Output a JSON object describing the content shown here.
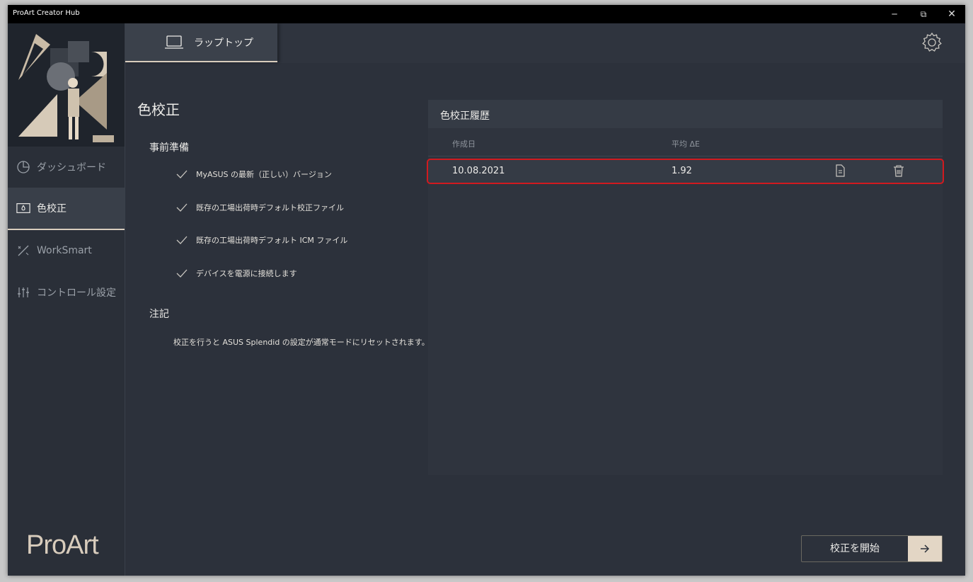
{
  "window": {
    "title": "ProArt Creator Hub"
  },
  "titlebar": {
    "minimize": "─",
    "maximize": "⧉",
    "close": "✕"
  },
  "sidebar": {
    "items": [
      {
        "label": "ダッシュボード",
        "icon": "pie-chart-icon"
      },
      {
        "label": "色校正",
        "icon": "calibration-icon",
        "active": true
      },
      {
        "label": "WorkSmart",
        "icon": "magic-wand-icon"
      },
      {
        "label": "コントロール設定",
        "icon": "sliders-icon"
      }
    ],
    "logo": "ProArt"
  },
  "topbar": {
    "tab_label": "ラップトップ",
    "tab_icon": "laptop-icon",
    "settings_icon": "gear-icon"
  },
  "main": {
    "title": "色校正",
    "prep_title": "事前準備",
    "prep_items": [
      "MyASUS の最新（正しい）バージョン",
      "既存の工場出荷時デフォルト校正ファイル",
      "既存の工場出荷時デフォルト ICM ファイル",
      "デバイスを電源に接続します"
    ],
    "note_title": "注記",
    "note_text": "校正を行うと ASUS Splendid の設定が通常モードにリセットされます。"
  },
  "history": {
    "title": "色校正履歴",
    "columns": [
      "作成日",
      "平均 ΔE"
    ],
    "rows": [
      {
        "date": "10.08.2021",
        "delta_e": "1.92",
        "actions": [
          "document-icon",
          "trash-icon"
        ]
      }
    ]
  },
  "actions": {
    "start_label": "校正を開始"
  },
  "colors": {
    "accent": "#d9cdbd",
    "highlight": "#d11a1f",
    "background": "#2c313b"
  }
}
